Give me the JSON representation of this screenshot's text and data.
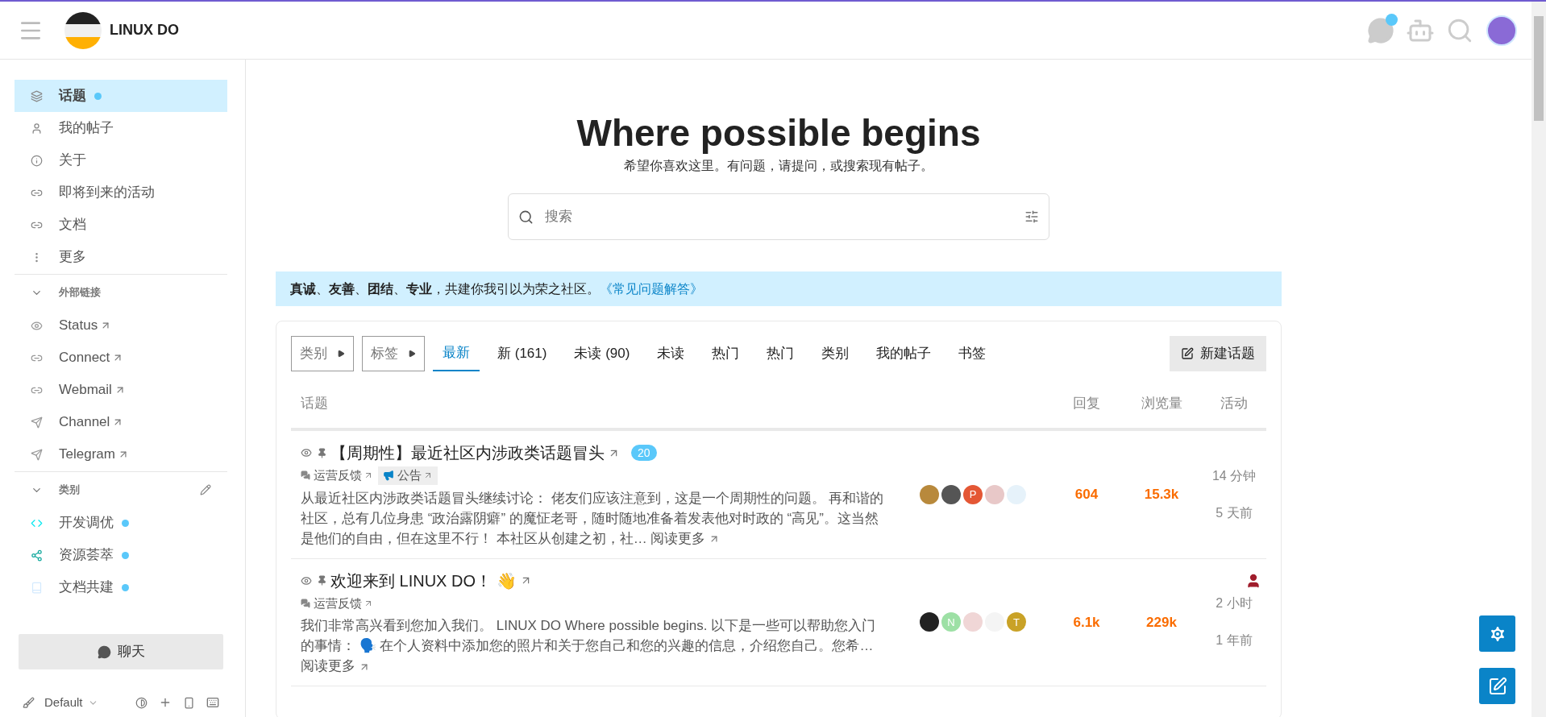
{
  "header": {
    "logo_text": "LINUX DO",
    "chat_unread": true
  },
  "sidebar": {
    "items": [
      {
        "label": "话题",
        "selected": true,
        "unread": true
      },
      {
        "label": "我的帖子",
        "selected": false,
        "unread": false
      },
      {
        "label": "关于",
        "selected": false,
        "unread": false
      },
      {
        "label": "即将到来的活动",
        "selected": false,
        "unread": false
      },
      {
        "label": "文档",
        "selected": false,
        "unread": false
      },
      {
        "label": "更多",
        "selected": false,
        "unread": false
      }
    ],
    "external_section": {
      "title": "外部链接",
      "expanded": true,
      "links": [
        "Status",
        "Connect",
        "Webmail",
        "Channel",
        "Telegram"
      ]
    },
    "category_section": {
      "title": "类别",
      "expanded": true,
      "items": [
        {
          "label": "开发调优",
          "color": "#0ce9f0",
          "unread": true
        },
        {
          "label": "资源荟萃",
          "color": "#12a89d",
          "unread": true
        },
        {
          "label": "文档共建",
          "color": "#d4eafe",
          "unread": true
        }
      ]
    },
    "chat_button": "聊天",
    "theme": "Default"
  },
  "hero": {
    "title": "Where possible begins",
    "subtitle": "希望你喜欢这里。有问题，请提问，或搜索现有帖子。",
    "search_placeholder": "搜索"
  },
  "banner": {
    "text": "**真诚**、**友善**、**团结**、**专业**，共建你我引以为荣之社区。",
    "link": "《常见问题解答》"
  },
  "nav": {
    "dropdowns": [
      "类别",
      "标签"
    ],
    "tabs": [
      {
        "label": "最新",
        "selected": true
      },
      {
        "label": "新 (161)",
        "selected": false
      },
      {
        "label": "未读 (90)",
        "selected": false
      },
      {
        "label": "未读",
        "selected": false
      },
      {
        "label": "热门",
        "selected": false
      },
      {
        "label": "热门",
        "selected": false
      },
      {
        "label": "类别",
        "selected": false
      },
      {
        "label": "我的帖子",
        "selected": false
      },
      {
        "label": "书签",
        "selected": false
      }
    ],
    "new_topic": "新建话题"
  },
  "table": {
    "columns": [
      "话题",
      "回复",
      "浏览量",
      "活动"
    ],
    "rows": [
      {
        "title": "【周期性】最近社区内涉政类话题冒头",
        "reply_badge": "20",
        "user_marker": false,
        "tags": [
          {
            "kind": "category",
            "label": "运营反馈"
          },
          {
            "kind": "tag",
            "label": "公告"
          }
        ],
        "excerpt": "从最近社区内涉政类话题冒头继续讨论： 佬友们应该注意到，这是一个周期性的问题。 再和谐的社区，总有几位身患 “政治露阴癖” 的魔怔老哥，随时随地准备着发表他对时政的 “高见”。这当然是他们的自由，但在这里不行！ 本社区从创建之初，社…",
        "read_more": "阅读更多",
        "posters": [
          {
            "color": "#b8893c"
          },
          {
            "color": "#555555"
          },
          {
            "letter": "P",
            "color": "#e45735"
          },
          {
            "color": "#e8c8c8"
          },
          {
            "color": "#e6f2fa"
          }
        ],
        "replies": "604",
        "views": "15.3k",
        "activity": [
          "14 分钟",
          "5 天前"
        ]
      },
      {
        "title": "欢迎来到 LINUX DO！ 👋",
        "user_marker": true,
        "tags": [
          {
            "kind": "category",
            "label": "运营反馈"
          }
        ],
        "excerpt": "我们非常高兴看到您加入我们。 LINUX DO Where possible begins. 以下是一些可以帮助您入门的事情： 🗣️ 在个人资料中添加您的照片和关于您自己和您的兴趣的信息，介绍您自己。您希…",
        "read_more": "阅读更多",
        "posters": [
          {
            "color": "#222222"
          },
          {
            "letter": "N",
            "color": "#9de0a5"
          },
          {
            "color": "#f0d6d6"
          },
          {
            "color": "#f4f4f4"
          },
          {
            "letter": "T",
            "color": "#c9a227"
          }
        ],
        "replies": "6.1k",
        "views": "229k",
        "activity": [
          "2 小时",
          "1 年前"
        ]
      }
    ]
  }
}
